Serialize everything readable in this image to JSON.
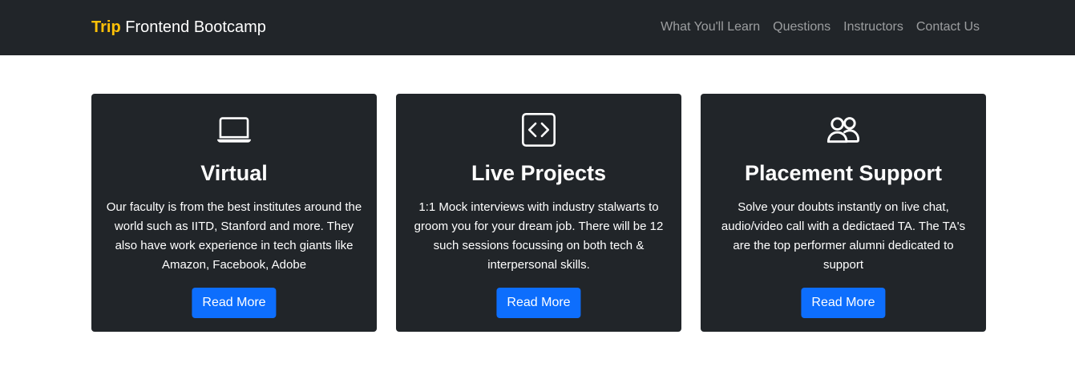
{
  "navbar": {
    "brand_accent": "Trip",
    "brand_text": " Frontend Bootcamp",
    "links": [
      "What You'll Learn",
      "Questions",
      "Instructors",
      "Contact Us"
    ]
  },
  "cards": [
    {
      "icon": "laptop-icon",
      "title": "Virtual",
      "text": "Our faculty is from the best institutes around the world such as IITD, Stanford and more. They also have work experience in tech giants like Amazon, Facebook, Adobe",
      "button": "Read More"
    },
    {
      "icon": "code-square-icon",
      "title": "Live Projects",
      "text": "1:1 Mock interviews with industry stalwarts to groom you for your dream job. There will be 12 such sessions focussing on both tech & interpersonal skills.",
      "button": "Read More"
    },
    {
      "icon": "people-icon",
      "title": "Placement Support",
      "text": "Solve your doubts instantly on live chat, audio/video call with a dedictaed TA. The TA's are the top performer alumni dedicated to support",
      "button": "Read More"
    }
  ],
  "colors": {
    "navbar_bg": "#212529",
    "card_bg": "#212529",
    "brand_accent": "#ffc107",
    "button_bg": "#0d6efd",
    "nav_link": "#8c8f92"
  }
}
